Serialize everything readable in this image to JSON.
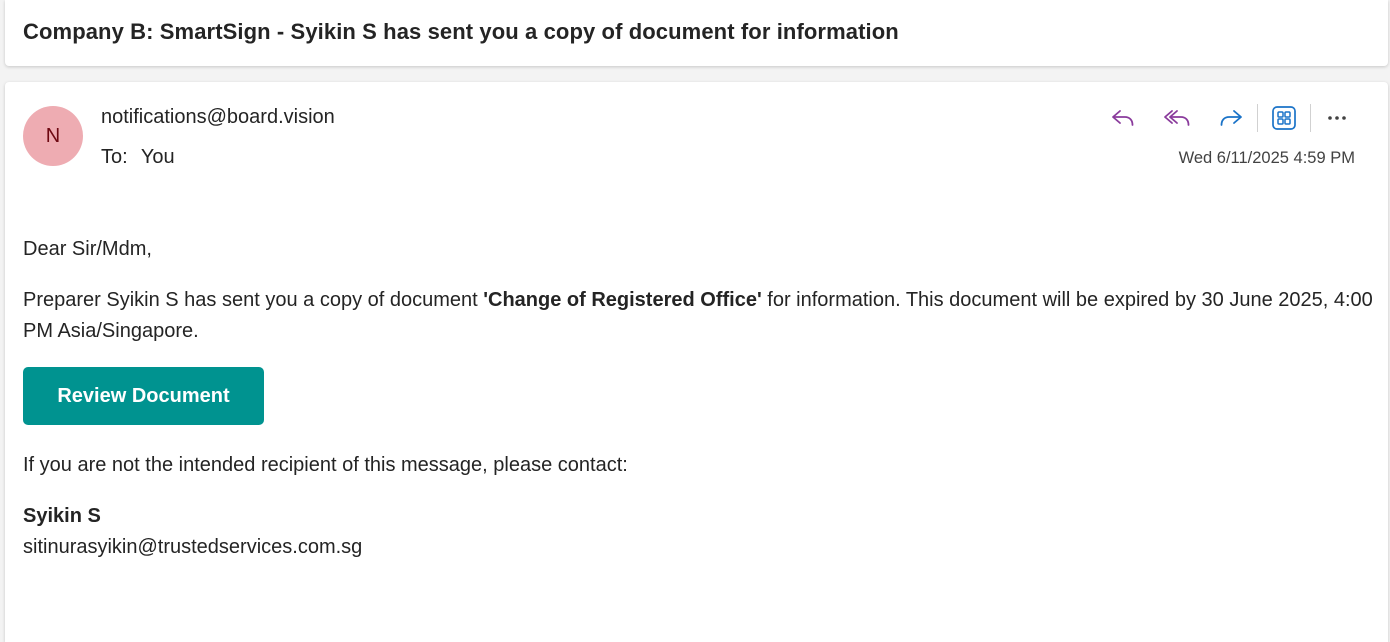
{
  "subject": "Company B: SmartSign - Syikin S has sent you a copy of document for information",
  "message": {
    "avatar_initial": "N",
    "avatar_color": "#eeacb2",
    "sender": "notifications@board.vision",
    "to_label": "To:",
    "to_value": "You",
    "date": "Wed 6/11/2025 4:59 PM",
    "actions": [
      {
        "name": "reply",
        "icon": "reply-icon",
        "color": "#8a3b9c"
      },
      {
        "name": "reply-all",
        "icon": "reply-all-icon",
        "color": "#8a3b9c"
      },
      {
        "name": "forward",
        "icon": "forward-icon",
        "color": "#1a73c8"
      },
      {
        "name": "apps",
        "icon": "apps-icon",
        "color": "#1a73c8"
      },
      {
        "name": "more",
        "icon": "more-icon",
        "color": "#424242"
      }
    ]
  },
  "body": {
    "greeting": "Dear Sir/Mdm,",
    "para_prefix": "Preparer Syikin S has sent you a copy of document ",
    "document_name": "'Change of Registered Office'",
    "para_suffix": " for information. This document will be expired by 30 June 2025, 4:00 PM Asia/Singapore.",
    "button_label": "Review Document",
    "button_color": "#009390",
    "contact_line": "If you are not the intended recipient of this message, please contact:",
    "contact_name": "Syikin S",
    "contact_email": "sitinurasyikin@trustedservices.com.sg"
  }
}
